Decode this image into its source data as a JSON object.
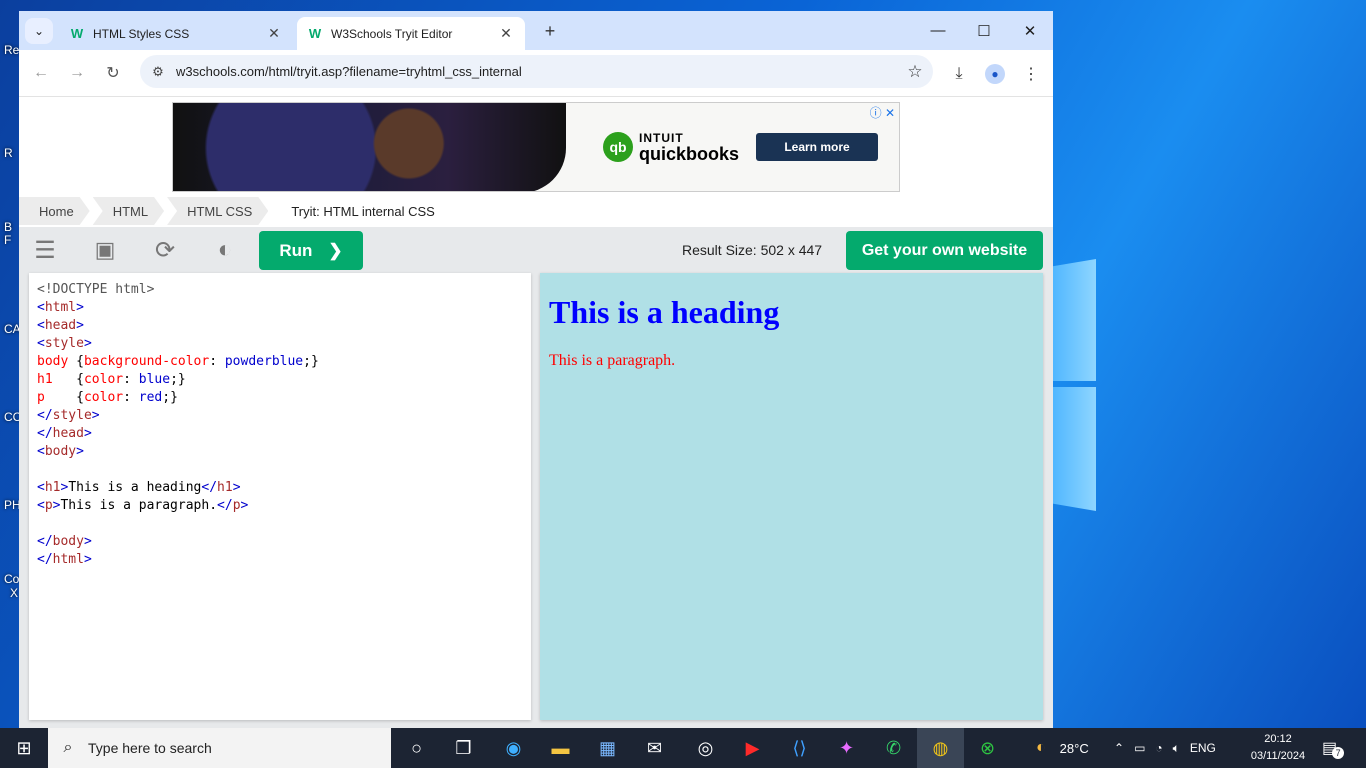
{
  "tabs": [
    {
      "label": "HTML Styles CSS",
      "favicon": "w3schools-favicon"
    },
    {
      "label": "W3Schools Tryit Editor",
      "favicon": "w3schools-favicon"
    }
  ],
  "address_bar": {
    "url": "w3schools.com/html/tryit.asp?filename=tryhtml_css_internal"
  },
  "ad": {
    "brand_line1": "INTUIT",
    "brand_line2": "quickbooks",
    "cta": "Learn more"
  },
  "breadcrumbs": [
    "Home",
    "HTML",
    "HTML CSS",
    "Tryit: HTML internal CSS"
  ],
  "editor_toolbar": {
    "run_label": "Run",
    "run_chevron": "❯",
    "result_size": "Result Size: 502 x 447",
    "get_website": "Get your own website"
  },
  "code_lines": [
    "<!DOCTYPE html>",
    "<html>",
    "<head>",
    "<style>",
    "body {background-color: powderblue;}",
    "h1   {color: blue;}",
    "p    {color: red;}",
    "</style>",
    "</head>",
    "<body>",
    "",
    "<h1>This is a heading</h1>",
    "<p>This is a paragraph.</p>",
    "",
    "</body>",
    "</html>"
  ],
  "result": {
    "heading": "This is a heading",
    "paragraph": "This is a paragraph."
  },
  "taskbar": {
    "search_placeholder": "Type here to search",
    "weather": "28°C",
    "language": "ENG",
    "time": "20:12",
    "date": "03/11/2024",
    "notification_count": "7"
  },
  "desktop_labels": [
    "Re",
    "R",
    "B",
    "F",
    "CA",
    "CC",
    "PH",
    "Co",
    "X"
  ],
  "colors": {
    "w3_green": "#04aa6d",
    "result_bg": "#b0e0e6",
    "heading": "#0000ff",
    "paragraph": "#ff0000"
  }
}
